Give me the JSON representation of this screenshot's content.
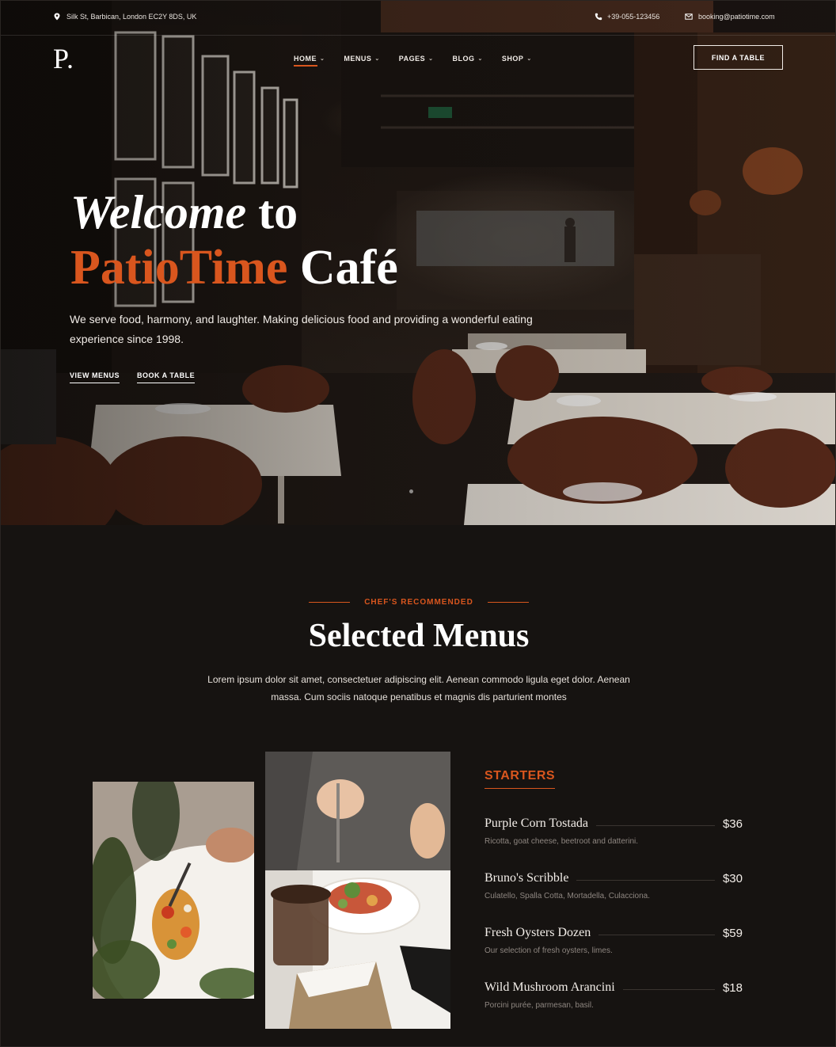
{
  "topbar": {
    "address": "Silk St, Barbican, London EC2Y 8DS, UK",
    "phone": "+39-055-123456",
    "email": "booking@patiotime.com"
  },
  "header": {
    "logo": "P.",
    "nav": [
      {
        "label": "HOME",
        "active": true
      },
      {
        "label": "MENUS",
        "active": false
      },
      {
        "label": "PAGES",
        "active": false
      },
      {
        "label": "BLOG",
        "active": false
      },
      {
        "label": "SHOP",
        "active": false
      }
    ],
    "cta": "FIND A TABLE"
  },
  "hero": {
    "title_welcome": "Welcome",
    "title_to": "to",
    "title_brand": "PatioTime",
    "title_cafe": "Café",
    "description": "We serve food, harmony, and laughter. Making delicious food and providing a wonderful eating experience since 1998.",
    "link_menus": "VIEW MENUS",
    "link_book": "BOOK A TABLE"
  },
  "menus_section": {
    "eyebrow": "CHEF'S RECOMMENDED",
    "title": "Selected Menus",
    "description": "Lorem ipsum dolor sit amet, consectetuer adipiscing elit. Aenean commodo ligula eget dolor. Aenean massa. Cum sociis natoque penatibus et magnis dis parturient montes"
  },
  "starters": {
    "heading": "STARTERS",
    "items": [
      {
        "name": "Purple Corn Tostada",
        "price": "$36",
        "desc": "Ricotta, goat cheese, beetroot and datterini."
      },
      {
        "name": "Bruno's Scribble",
        "price": "$30",
        "desc": "Culatello, Spalla Cotta, Mortadella, Culacciona."
      },
      {
        "name": "Fresh Oysters Dozen",
        "price": "$59",
        "desc": "Our selection of fresh oysters, limes."
      },
      {
        "name": "Wild Mushroom Arancini",
        "price": "$18",
        "desc": "Porcini purée, parmesan, basil."
      }
    ]
  },
  "colors": {
    "accent": "#d9561e",
    "background": "#161311"
  }
}
